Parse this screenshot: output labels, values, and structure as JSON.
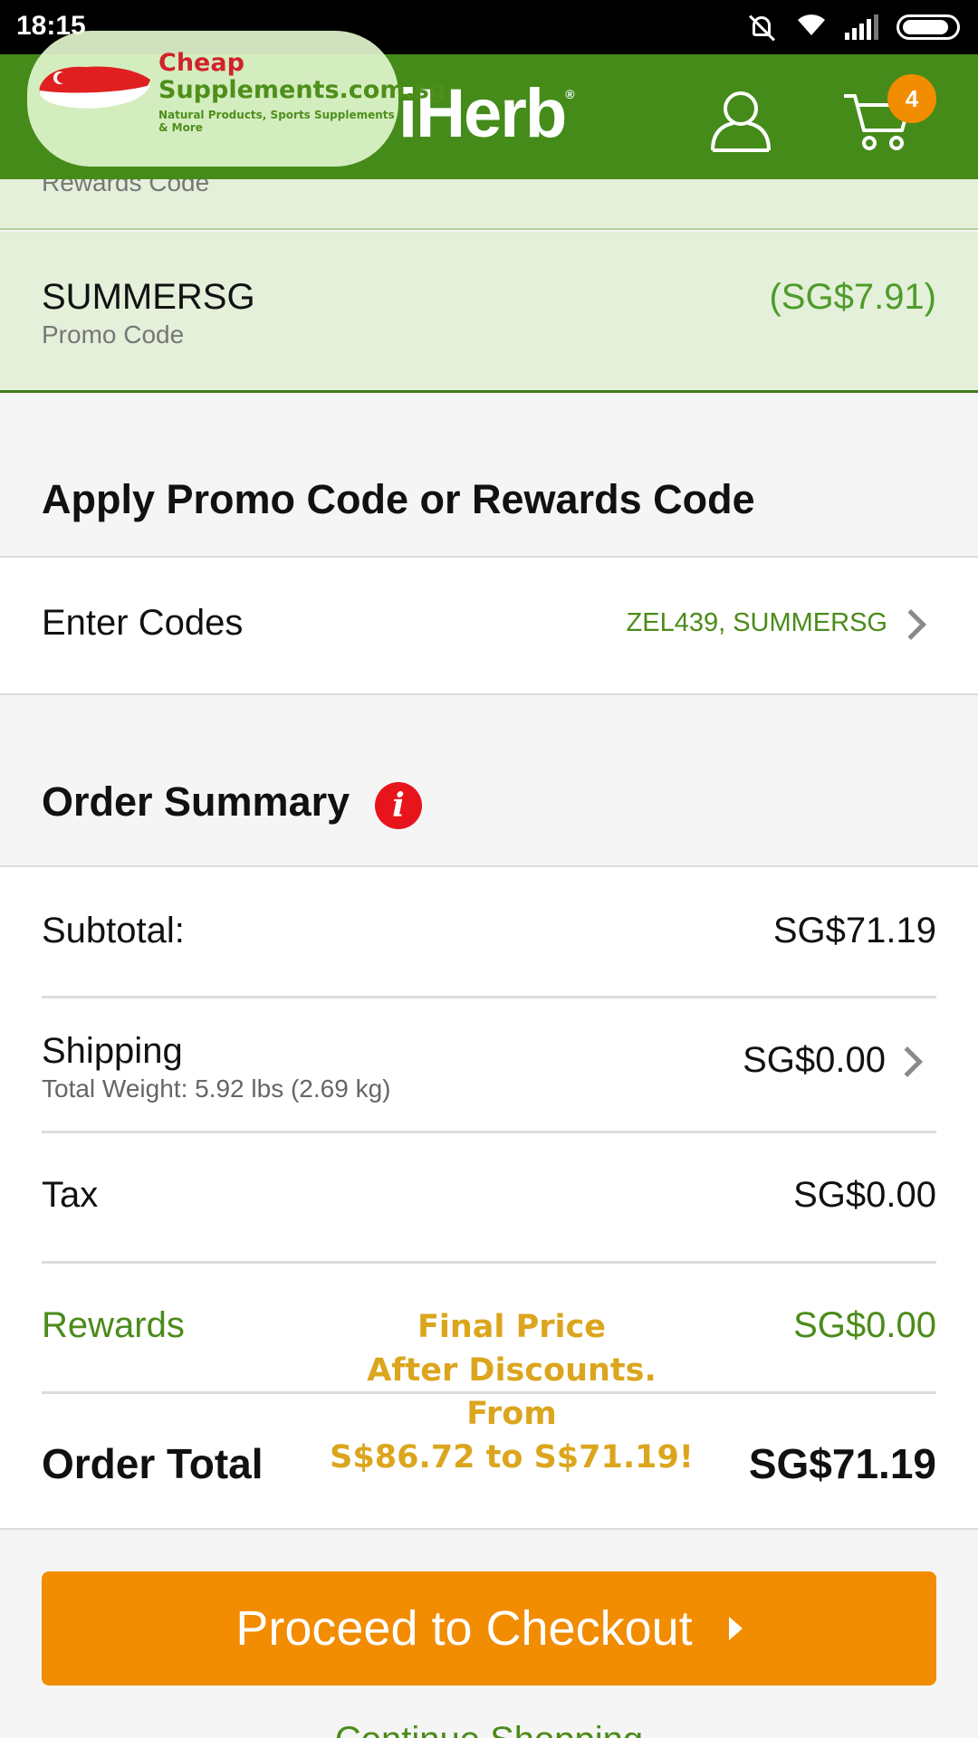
{
  "status_bar": {
    "time": "18:15",
    "icons": [
      "mute-icon",
      "wifi-icon",
      "signal-icon",
      "battery-icon"
    ]
  },
  "header": {
    "logo": {
      "line1": "Cheap",
      "line2": "Supplements.com.sg",
      "line3": "Natural Products, Sports Supplements & More"
    },
    "brand": "iHerb",
    "brand_mark": "®",
    "cart_count": "4",
    "icons": [
      "user-icon",
      "cart-icon"
    ]
  },
  "applied_codes": {
    "partial_type": "Rewards Code",
    "promo": {
      "code": "SUMMERSG",
      "type": "Promo Code",
      "amount": "(SG$7.91)"
    }
  },
  "apply_section": {
    "title": "Apply Promo Code or Rewards Code",
    "enter_label": "Enter Codes",
    "entered_codes": "ZEL439, SUMMERSG"
  },
  "order_summary": {
    "title": "Order Summary",
    "info_glyph": "i",
    "subtotal": {
      "label": "Subtotal:",
      "value": "SG$71.19"
    },
    "shipping": {
      "label": "Shipping",
      "weight": "Total Weight: 5.92 lbs (2.69 kg)",
      "value": "SG$0.00"
    },
    "tax": {
      "label": "Tax",
      "value": "SG$0.00"
    },
    "rewards": {
      "label": "Rewards",
      "value": "SG$0.00"
    },
    "total": {
      "label": "Order Total",
      "value": "SG$71.19"
    }
  },
  "overlay_text": [
    "Final Price",
    "After Discounts.",
    "From",
    "S$86.72 to S$71.19!"
  ],
  "checkout_button": "Proceed to Checkout",
  "continue_link": "Continue Shopping",
  "colors": {
    "header": "#458b1a",
    "accent_green": "#4b8b1a",
    "checkout": "#f28c00",
    "info_red": "#e8141c",
    "overlay": "#dba51d"
  }
}
